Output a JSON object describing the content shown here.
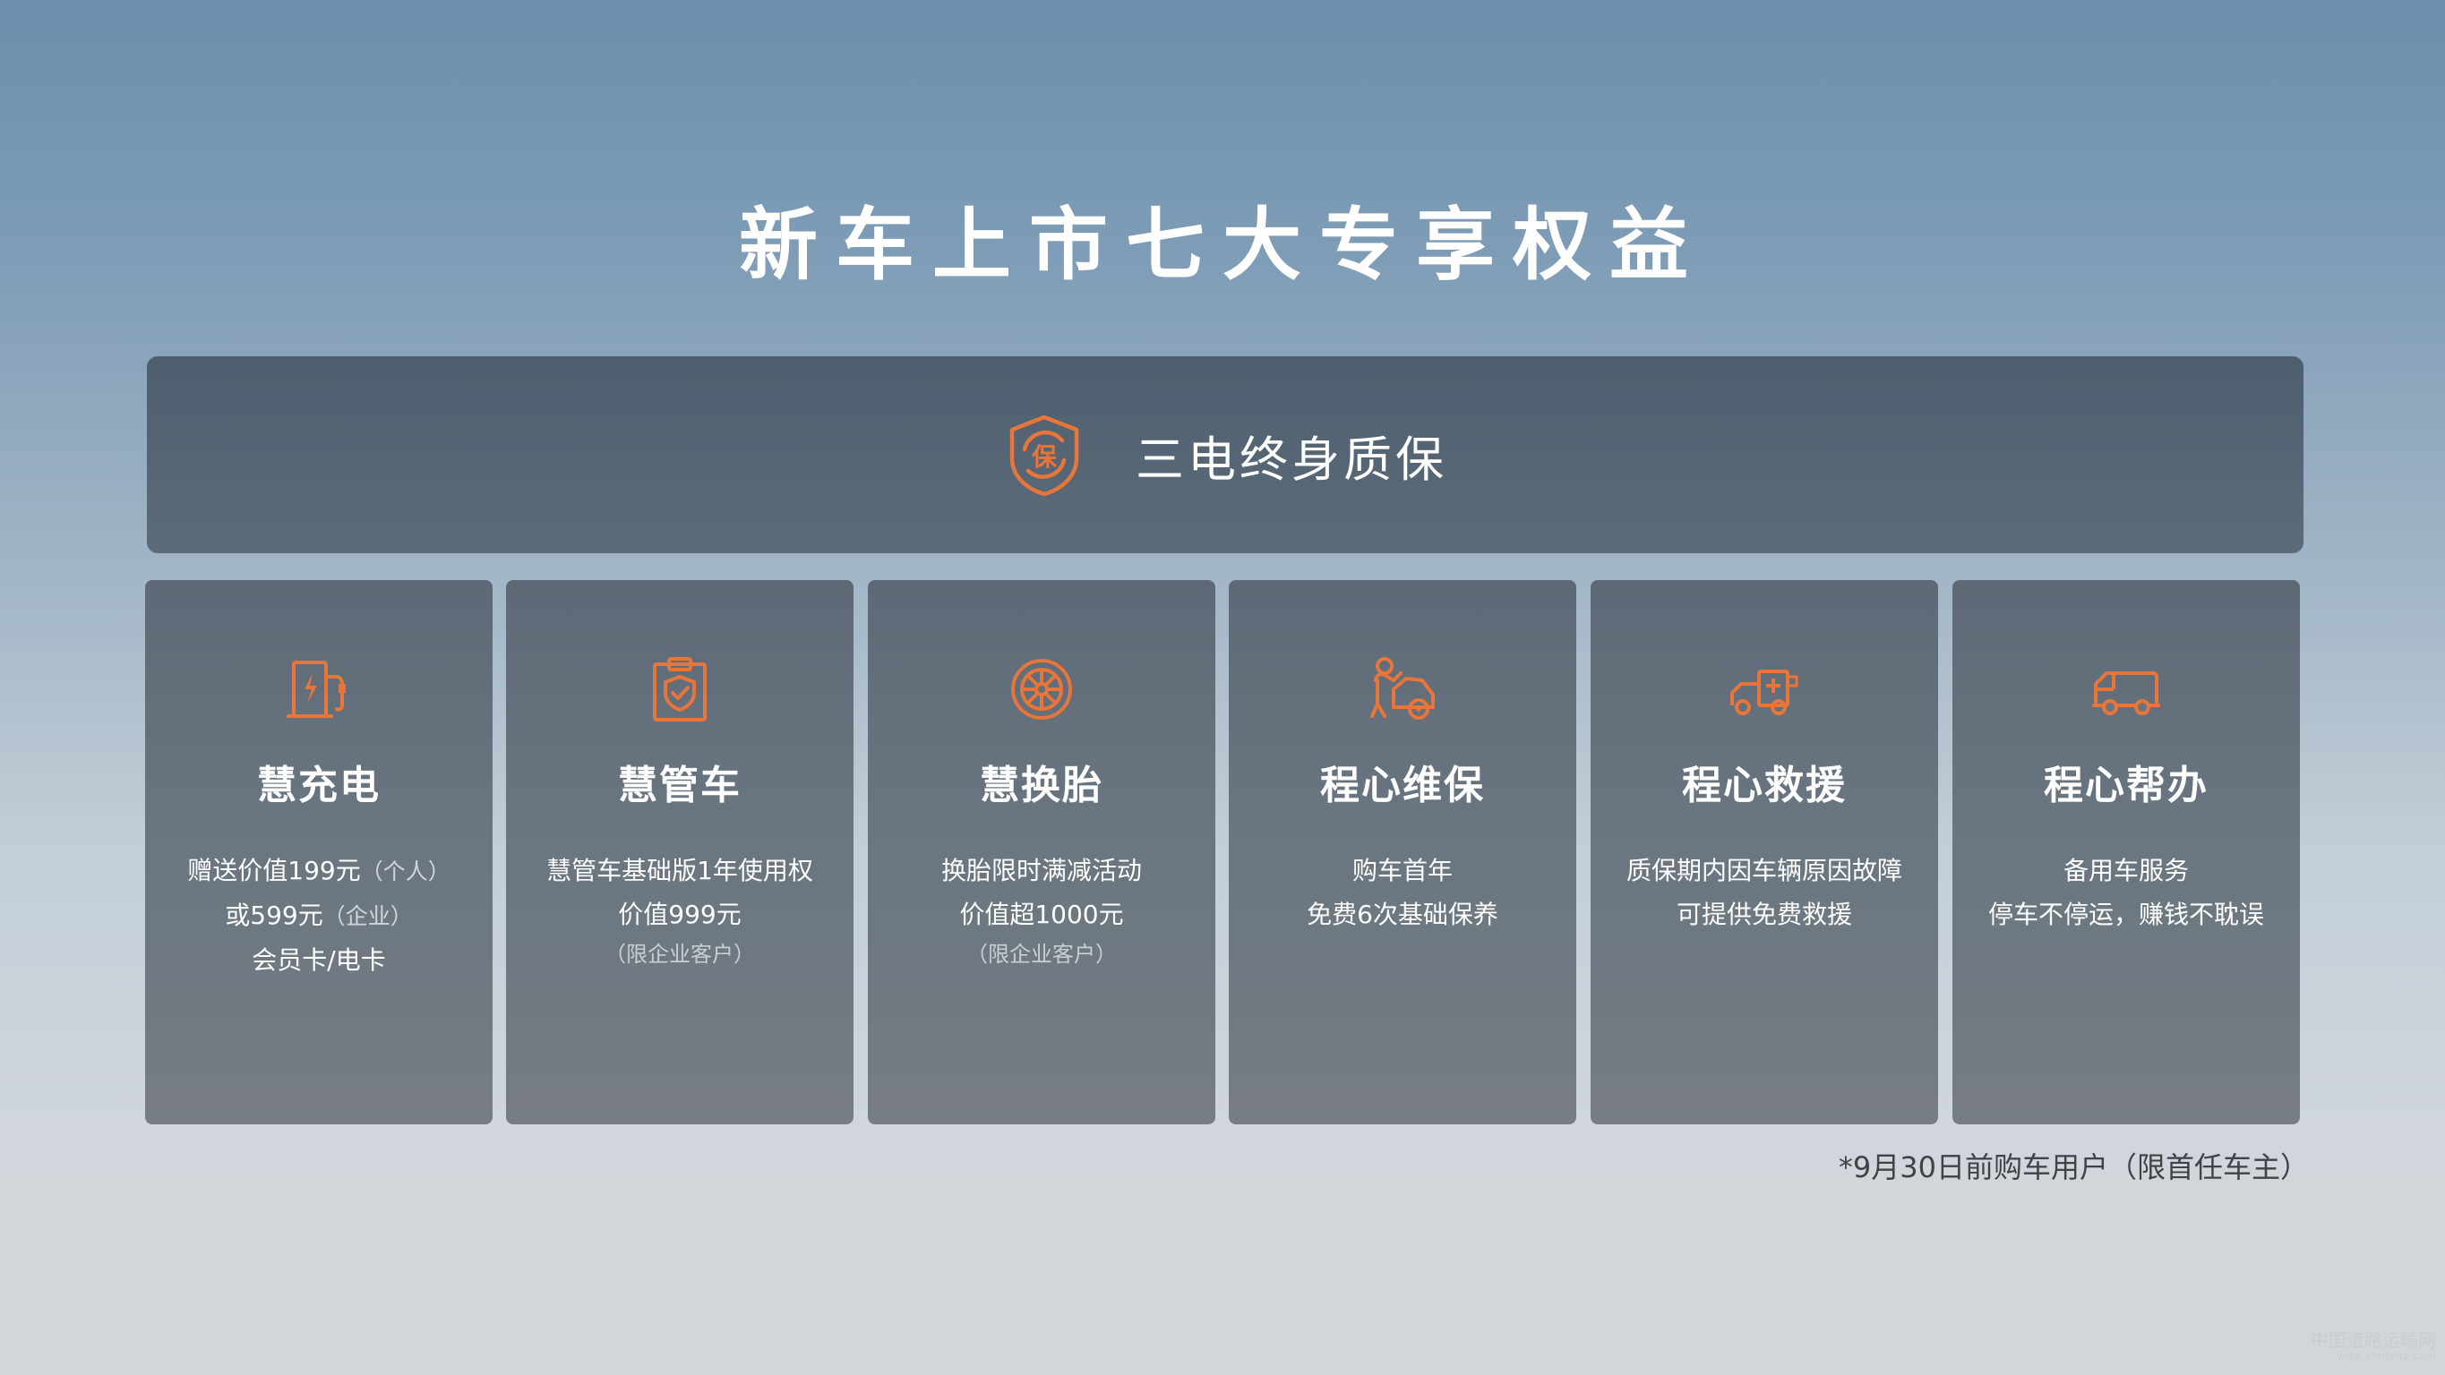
{
  "title": "新车上市七大专享权益",
  "banner": {
    "label": "三电终身质保",
    "icon": "shield-bao-icon",
    "icon_glyph": "保"
  },
  "cards": [
    {
      "icon": "charging-pile-icon",
      "title": "慧充电",
      "line1_main": "赠送价值199元",
      "line1_note": "（个人）",
      "line2_main": "或599元",
      "line2_note": "（企业）",
      "line3": "会员卡/电卡"
    },
    {
      "icon": "clipboard-shield-icon",
      "title": "慧管车",
      "line1": "慧管车基础版1年使用权",
      "line2": "价值999元",
      "line3": "（限企业客户）"
    },
    {
      "icon": "tire-icon",
      "title": "慧换胎",
      "line1": "换胎限时满减活动",
      "line2": "价值超1000元",
      "line3": "（限企业客户）"
    },
    {
      "icon": "mechanic-icon",
      "title": "程心维保",
      "line1": "购车首年",
      "line2": "免费6次基础保养"
    },
    {
      "icon": "tow-truck-icon",
      "title": "程心救援",
      "line1": "质保期内因车辆原因故障",
      "line2": "可提供免费救援"
    },
    {
      "icon": "van-icon",
      "title": "程心帮办",
      "line1": "备用车服务",
      "line2": "停车不停运，赚钱不耽误"
    }
  ],
  "footnote": "*9月30日前购车用户（限首任车主）",
  "watermark": {
    "line1": "中国道路运输网",
    "line2": "www.chinarta.com"
  },
  "colors": {
    "accent": "#e8753a",
    "banner": "#55636f",
    "card": "#6a7580"
  }
}
